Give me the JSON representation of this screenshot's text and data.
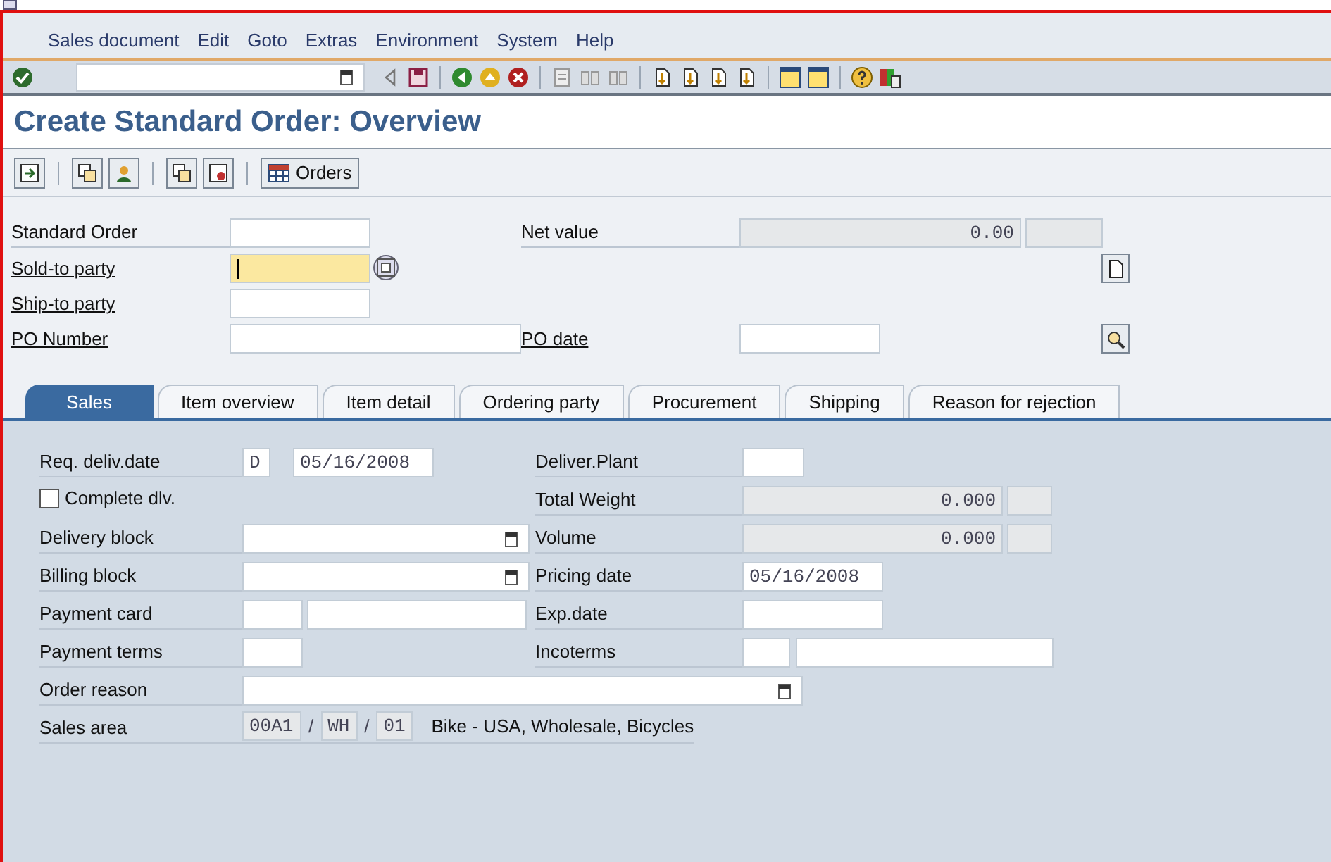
{
  "menu": [
    "Sales document",
    "Edit",
    "Goto",
    "Extras",
    "Environment",
    "System",
    "Help"
  ],
  "title": "Create Standard Order: Overview",
  "app_toolbar": {
    "orders_button": "Orders"
  },
  "header": {
    "standard_order": {
      "label": "Standard Order"
    },
    "net_value": {
      "label": "Net value",
      "value": "0.00"
    },
    "sold_to": {
      "label": "Sold-to party",
      "focused": true
    },
    "ship_to": {
      "label": "Ship-to party"
    },
    "po_number": {
      "label": "PO Number"
    },
    "po_date": {
      "label": "PO date"
    }
  },
  "tabs": [
    {
      "label": "Sales",
      "selected": true
    },
    {
      "label": "Item overview",
      "selected": false
    },
    {
      "label": "Item detail",
      "selected": false
    },
    {
      "label": "Ordering party",
      "selected": false
    },
    {
      "label": "Procurement",
      "selected": false
    },
    {
      "label": "Shipping",
      "selected": false
    },
    {
      "label": "Reason for rejection",
      "selected": false
    }
  ],
  "sales": {
    "req_deliv_date": {
      "label": "Req. deliv.date",
      "unit": "D",
      "value": "05/16/2008"
    },
    "complete_dlv": {
      "label": "Complete dlv.",
      "checked": false
    },
    "delivery_block": {
      "label": "Delivery block"
    },
    "billing_block": {
      "label": "Billing block"
    },
    "payment_card": {
      "label": "Payment card"
    },
    "payment_terms": {
      "label": "Payment terms"
    },
    "order_reason": {
      "label": "Order reason"
    },
    "sales_area": {
      "label": "Sales area",
      "sales_org": "00A1",
      "distr_channel": "WH",
      "division": "01",
      "separators": [
        "/",
        "/"
      ],
      "description": "Bike - USA, Wholesale, Bicycles"
    },
    "deliver_plant": {
      "label": "Deliver.Plant"
    },
    "total_weight": {
      "label": "Total Weight",
      "value": "0.000"
    },
    "volume": {
      "label": "Volume",
      "value": "0.000"
    },
    "pricing_date": {
      "label": "Pricing date",
      "value": "05/16/2008"
    },
    "exp_date": {
      "label": "Exp.date"
    },
    "incoterms": {
      "label": "Incoterms"
    }
  }
}
